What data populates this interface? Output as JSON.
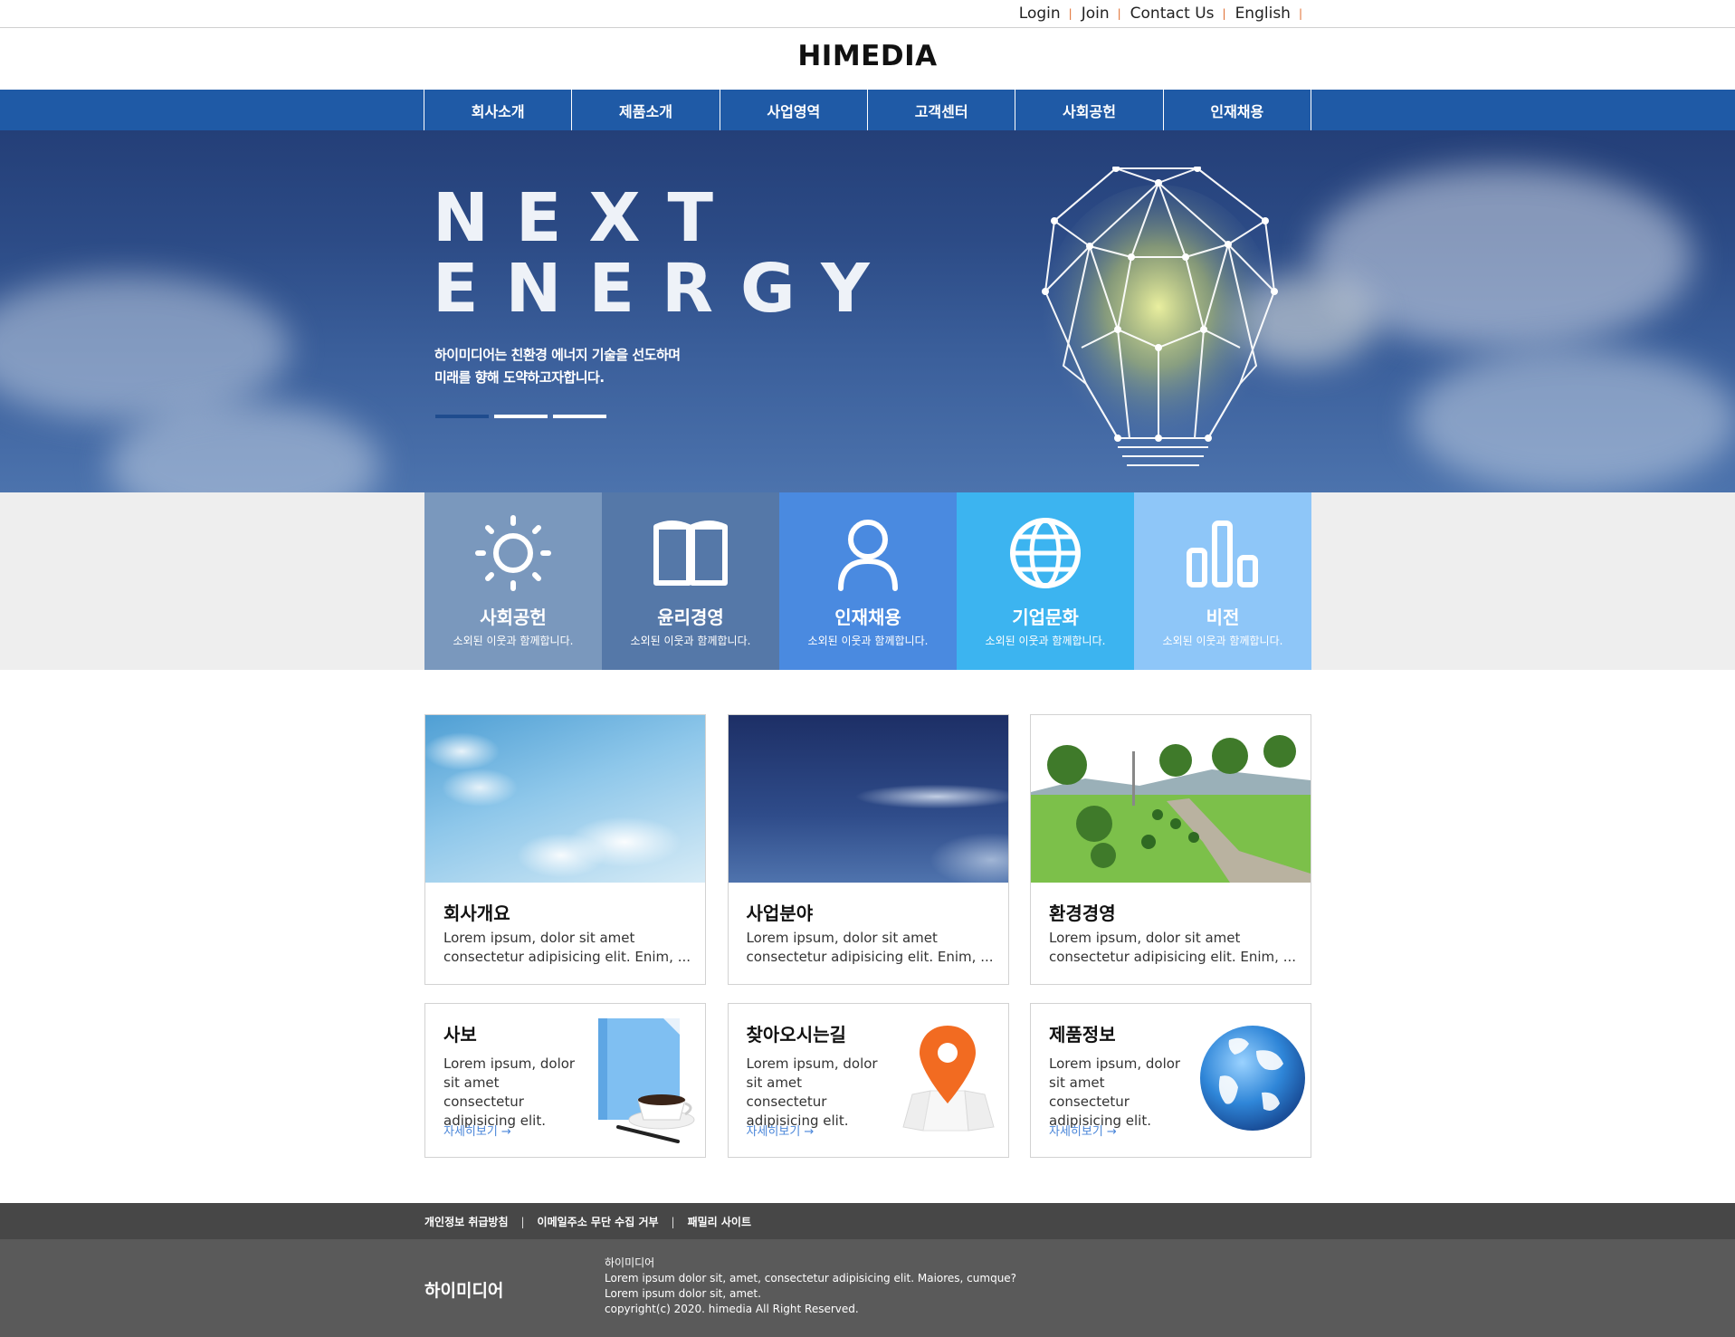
{
  "util_nav": [
    "Login",
    "Join",
    "Contact Us",
    "English"
  ],
  "logo": "HIMEDIA",
  "gnb": [
    "회사소개",
    "제품소개",
    "사업영역",
    "고객센터",
    "사회공헌",
    "인재채용"
  ],
  "hero": {
    "title_line1": "NEXT",
    "title_line2": "ENERGY",
    "desc_line1": "하이미디어는 친환경 에너지 기술을 선도하며",
    "desc_line2": "미래를 향해 도약하고자합니다."
  },
  "quick": [
    {
      "title": "사회공헌",
      "sub": "소외된 이웃과 함께합니다.",
      "icon": "sun-icon",
      "color": "#7a98bd"
    },
    {
      "title": "윤리경영",
      "sub": "소외된 이웃과 함께합니다.",
      "icon": "book-icon",
      "color": "#5578a8"
    },
    {
      "title": "인재채용",
      "sub": "소외된 이웃과 함께합니다.",
      "icon": "person-icon",
      "color": "#4a8ae0"
    },
    {
      "title": "기업문화",
      "sub": "소외된 이웃과 함께합니다.",
      "icon": "globe-icon",
      "color": "#3cb4f0"
    },
    {
      "title": "비전",
      "sub": "소외된 이웃과 함께합니다.",
      "icon": "bar-chart-icon",
      "color": "#8ec6f8"
    }
  ],
  "cards": [
    {
      "title": "회사개요",
      "line1": "Lorem ipsum, dolor sit amet",
      "line2": "consectetur adipisicing elit. Enim, ..."
    },
    {
      "title": "사업분야",
      "line1": "Lorem ipsum, dolor sit amet",
      "line2": "consectetur adipisicing elit. Enim, ..."
    },
    {
      "title": "환경경영",
      "line1": "Lorem ipsum, dolor sit amet",
      "line2": "consectetur adipisicing elit. Enim, ..."
    }
  ],
  "boxes": [
    {
      "title": "사보",
      "line1": "Lorem ipsum, dolor",
      "line2": "sit amet consectetur",
      "line3": "adipisicing elit.",
      "more": "자세히보기 →"
    },
    {
      "title": "찾아오시는길",
      "line1": "Lorem ipsum, dolor",
      "line2": "sit amet consectetur",
      "line3": "adipisicing elit.",
      "more": "자세히보기 →"
    },
    {
      "title": "제품정보",
      "line1": "Lorem ipsum, dolor",
      "line2": "sit amet consectetur",
      "line3": "adipisicing elit.",
      "more": "자세히보기 →"
    }
  ],
  "footer_nav": [
    "개인정보 취급방침",
    "이메일주소 무단 수집 거부",
    "패밀리 사이트"
  ],
  "footer": {
    "company": "하이미디어",
    "info_line1": "하이미디어",
    "info_line2": "Lorem ipsum dolor sit, amet, consectetur adipisicing elit. Maiores, cumque?",
    "info_line3": "Lorem ipsum dolor sit, amet.",
    "info_line4": "copyright(c) 2020. himedia All Right Reserved."
  }
}
